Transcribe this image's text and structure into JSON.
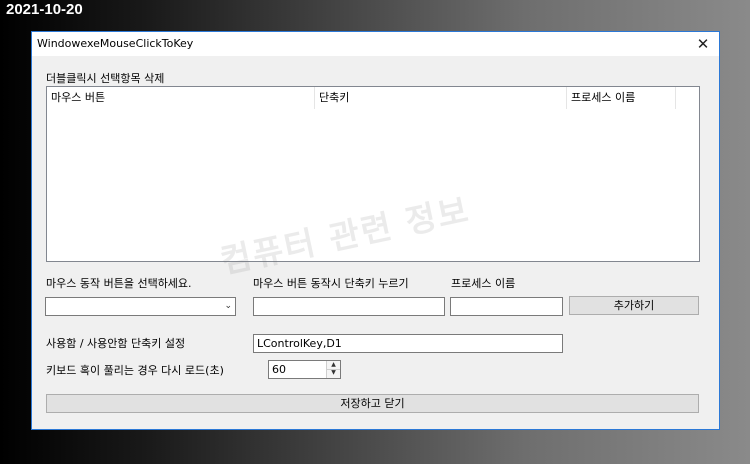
{
  "date": "2021-10-20",
  "window": {
    "title": "WindowexeMouseClickToKey",
    "close_icon": "close-icon"
  },
  "list": {
    "label": "더블클릭시 선택항목 삭제",
    "columns": [
      "마우스 버튼",
      "단축키",
      "프로세스 이름"
    ],
    "rows": []
  },
  "watermark": "컴퓨터 관련 정보",
  "form": {
    "mouse_button_label": "마우스 동작 버튼을 선택하세요.",
    "mouse_button_value": "",
    "shortcut_label": "마우스 버튼 동작시 단축키 누르기",
    "shortcut_value": "",
    "process_label": "프로세스 이름",
    "process_value": "",
    "add_button": "추가하기",
    "toggle_label": "사용함 / 사용안함 단축키 설정",
    "toggle_value": "LControlKey,D1",
    "reload_label": "키보드 혹이 풀리는 경우 다시 로드(초)",
    "reload_value": "60",
    "save_button": "저장하고 닫기"
  }
}
